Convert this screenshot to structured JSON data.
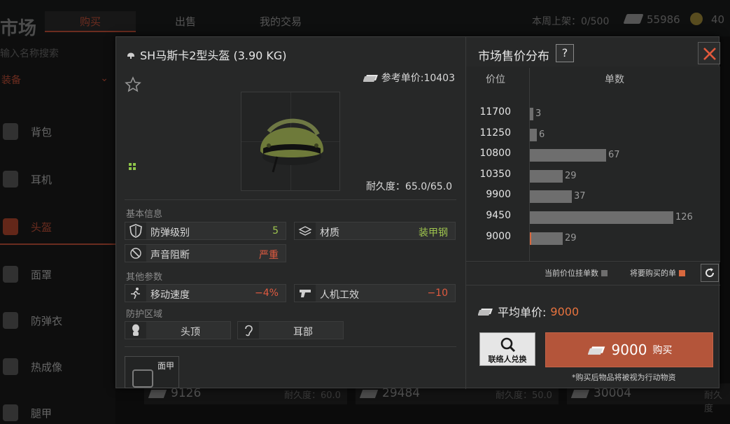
{
  "background": {
    "title": "市场",
    "tabs": [
      {
        "label": "购买",
        "active": true
      },
      {
        "label": "出售",
        "active": false
      },
      {
        "label": "我的交易",
        "active": false
      }
    ],
    "weekly_listing_label": "本周上架：0/500",
    "cash": "55986",
    "coins": "40",
    "search_placeholder": "输入名称搜索",
    "category": "装备",
    "sidebar_items": [
      {
        "label": "背包",
        "icon": "backpack-icon"
      },
      {
        "label": "耳机",
        "icon": "headphone-icon"
      },
      {
        "label": "头盔",
        "icon": "helmet-icon",
        "active": true
      },
      {
        "label": "面罩",
        "icon": "mask-icon"
      },
      {
        "label": "防弹衣",
        "icon": "vest-icon"
      },
      {
        "label": "热成像",
        "icon": "thermal-icon"
      },
      {
        "label": "腿甲",
        "icon": "legarmor-icon"
      }
    ],
    "listings": [
      {
        "price": "9126",
        "durability": "耐久度：60.0"
      },
      {
        "price": "29484",
        "durability": "耐久度：50.0"
      },
      {
        "price": "30004",
        "durability": "耐久度"
      }
    ]
  },
  "item": {
    "title": "SH马斯卡2型头盔 (3.90 KG)",
    "ref_price_label": "参考单价:10403",
    "durability": "耐久度：65.0/65.0"
  },
  "basic_info": {
    "heading": "基本信息",
    "stats": [
      {
        "label": "防弹级别",
        "value": "5",
        "color": "#9ec44e",
        "icon": "shield-icon"
      },
      {
        "label": "材质",
        "value": "装甲钢",
        "color": "#9ec44e",
        "icon": "material-icon"
      },
      {
        "label": "声音阻断",
        "value": "严重",
        "color": "#e05a40",
        "icon": "sound-block-icon"
      }
    ]
  },
  "other_params": {
    "heading": "其他参数",
    "stats": [
      {
        "label": "移动速度",
        "value": "−4%",
        "color": "#e05a40",
        "icon": "run-icon"
      },
      {
        "label": "人机工效",
        "value": "−10",
        "color": "#e05a40",
        "icon": "pistol-icon"
      }
    ]
  },
  "protection": {
    "heading": "防护区域",
    "zones": [
      {
        "label": "头顶",
        "icon": "head-icon"
      },
      {
        "label": "耳部",
        "icon": "ear-icon"
      }
    ]
  },
  "mod_slot": {
    "label": "面甲"
  },
  "market": {
    "title": "市场售价分布",
    "help": "?",
    "col_price": "价位",
    "col_count": "单数",
    "legend_current": "当前价位挂单数",
    "legend_buy": "将要购买的单",
    "legend_current_color": "#6e6e6e",
    "legend_buy_color": "#d8683e",
    "avg_label": "平均单价:",
    "avg_value": "9000",
    "broker_label": "联络人兑换",
    "buy_price": "9000",
    "buy_label": "购买",
    "buy_note": "*购买后物品将被视为行动物资"
  },
  "chart_data": {
    "type": "bar",
    "orientation": "horizontal",
    "categories": [
      "11700",
      "11250",
      "10800",
      "10350",
      "9900",
      "9450",
      "9000"
    ],
    "values": [
      3,
      6,
      67,
      29,
      37,
      126,
      29
    ],
    "xlabel": "单数",
    "ylabel": "价位",
    "highlight_category": "9000"
  }
}
